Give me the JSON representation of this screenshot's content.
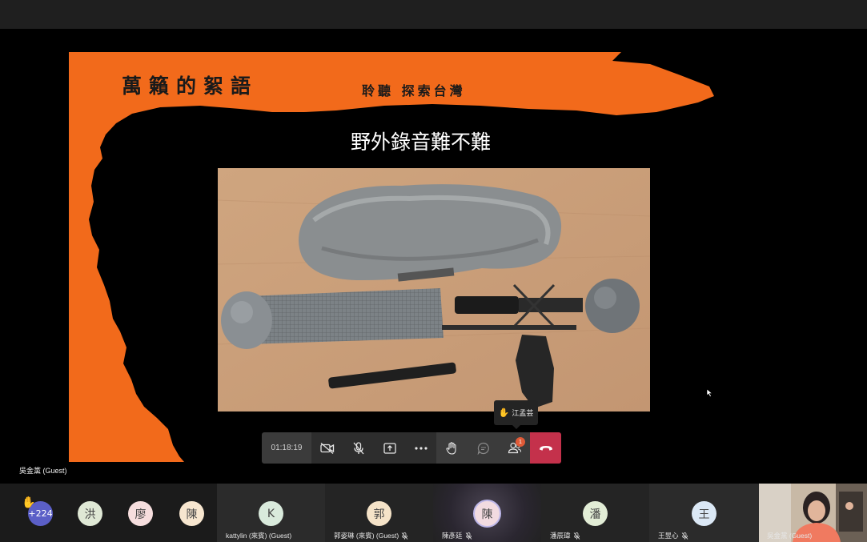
{
  "slide": {
    "title": "萬籟的絮語",
    "subtitle": "聆聽 探索台灣",
    "heading": "野外錄音難不難"
  },
  "presenter": {
    "name": "吳金黨 (Guest)"
  },
  "toolbar": {
    "timer": "01:18:19",
    "participants_badge": "1"
  },
  "raised_hand_tooltip": {
    "name": "江孟芸"
  },
  "colors": {
    "slide_orange": "#f26a1b",
    "hangup_red": "#c4314b",
    "toolbar": "#2d2d2d"
  },
  "participants": [
    {
      "initial": "+224",
      "hand_raised": true,
      "color": "#5b5fc7"
    },
    {
      "initial": "洪",
      "color": "#dfe8d5"
    },
    {
      "initial": "廖",
      "color": "#f6dede"
    },
    {
      "initial": "陳",
      "color": "#f7e6cf"
    },
    {
      "initial": "K",
      "name": "kattylin (來賓) (Guest)",
      "color": "#d9eadc"
    },
    {
      "initial": "郭",
      "name": "郭姿琳 (來賓) (Guest)",
      "color": "#f5e3c8",
      "muted": true
    },
    {
      "initial": "陳",
      "name": "陳彥廷",
      "color": "#f2dbe0",
      "muted": true,
      "speaking": true
    },
    {
      "initial": "潘",
      "name": "潘辰瑋",
      "color": "#e2edd6",
      "muted": true
    },
    {
      "initial": "王",
      "name": "王昱心",
      "color": "#dbe8f5",
      "muted": true
    }
  ],
  "self_video": {
    "name": "吳金黨 (Guest)"
  }
}
